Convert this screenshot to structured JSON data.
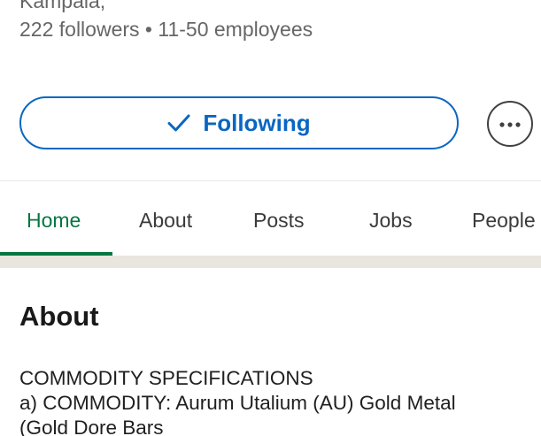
{
  "company": {
    "location": "Kampala,",
    "followers": "222 followers",
    "separator": "•",
    "employees": "11-50 employees"
  },
  "actions": {
    "following_label": "Following",
    "more_icon": "ellipsis-icon",
    "check_icon": "checkmark-icon"
  },
  "tabs": [
    {
      "label": "Home",
      "active": true
    },
    {
      "label": "About",
      "active": false
    },
    {
      "label": "Posts",
      "active": false
    },
    {
      "label": "Jobs",
      "active": false
    },
    {
      "label": "People",
      "active": false
    }
  ],
  "about": {
    "heading": "About",
    "lines": [
      "COMMODITY SPECIFICATIONS",
      "a)  COMMODITY: Aurum Utalium (AU) Gold Metal",
      "(Gold Dore Bars"
    ]
  },
  "colors": {
    "accent_blue": "#0a66c2",
    "active_tab_green": "#057642",
    "secondary_text": "#666666",
    "section_gap": "#e9e5df"
  }
}
